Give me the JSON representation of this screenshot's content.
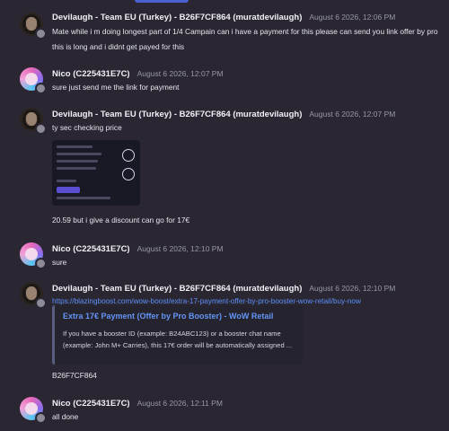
{
  "messages": [
    {
      "author": "Devilaugh - Team EU (Turkey) - B26F7CF864 (muratdevilaugh)",
      "time": "August 6 2026, 12:06 PM",
      "lines": [
        "Mate while i m doing longest part of 1/4 Campain can i have a payment for this please can send you link offer by pro",
        "this is long and i didnt get payed for this"
      ]
    },
    {
      "author": "Nico (C225431E7C)",
      "time": "August 6 2026, 12:07 PM",
      "lines": [
        "sure just send me the link for payment"
      ]
    },
    {
      "author": "Devilaugh - Team EU (Turkey) - B26F7CF864 (muratdevilaugh)",
      "time": "August 6 2026, 12:07 PM",
      "lines": [
        "ty sec checking price"
      ],
      "after_image": "20.59 but i give a discount can go for 17€"
    },
    {
      "author": "Nico (C225431E7C)",
      "time": "August 6 2026, 12:10 PM",
      "lines": [
        "sure"
      ]
    },
    {
      "author": "Devilaugh - Team EU (Turkey) - B26F7CF864 (muratdevilaugh)",
      "time": "August 6 2026, 12:10 PM",
      "link": "https://blazingboost.com/wow-boost/extra-17-payment-offer-by-pro-booster-wow-retail/buy-now",
      "embed": {
        "title": "Extra 17€ Payment (Offer by Pro Booster) - WoW Retail",
        "desc1": "If you have a booster ID (example: B24ABC123) or a booster chat name",
        "desc2": "(example: John M+ Carries), this 17€ order will be automatically assigned ..."
      },
      "after": "B26F7CF864"
    },
    {
      "author": "Nico (C225431E7C)",
      "time": "August 6 2026, 12:11 PM",
      "lines": [
        "all done"
      ]
    }
  ],
  "colors": {
    "background": "#2a2733",
    "link": "#5b8ff5",
    "timestamp": "#9a97a6",
    "accent": "#5a4fd0"
  }
}
